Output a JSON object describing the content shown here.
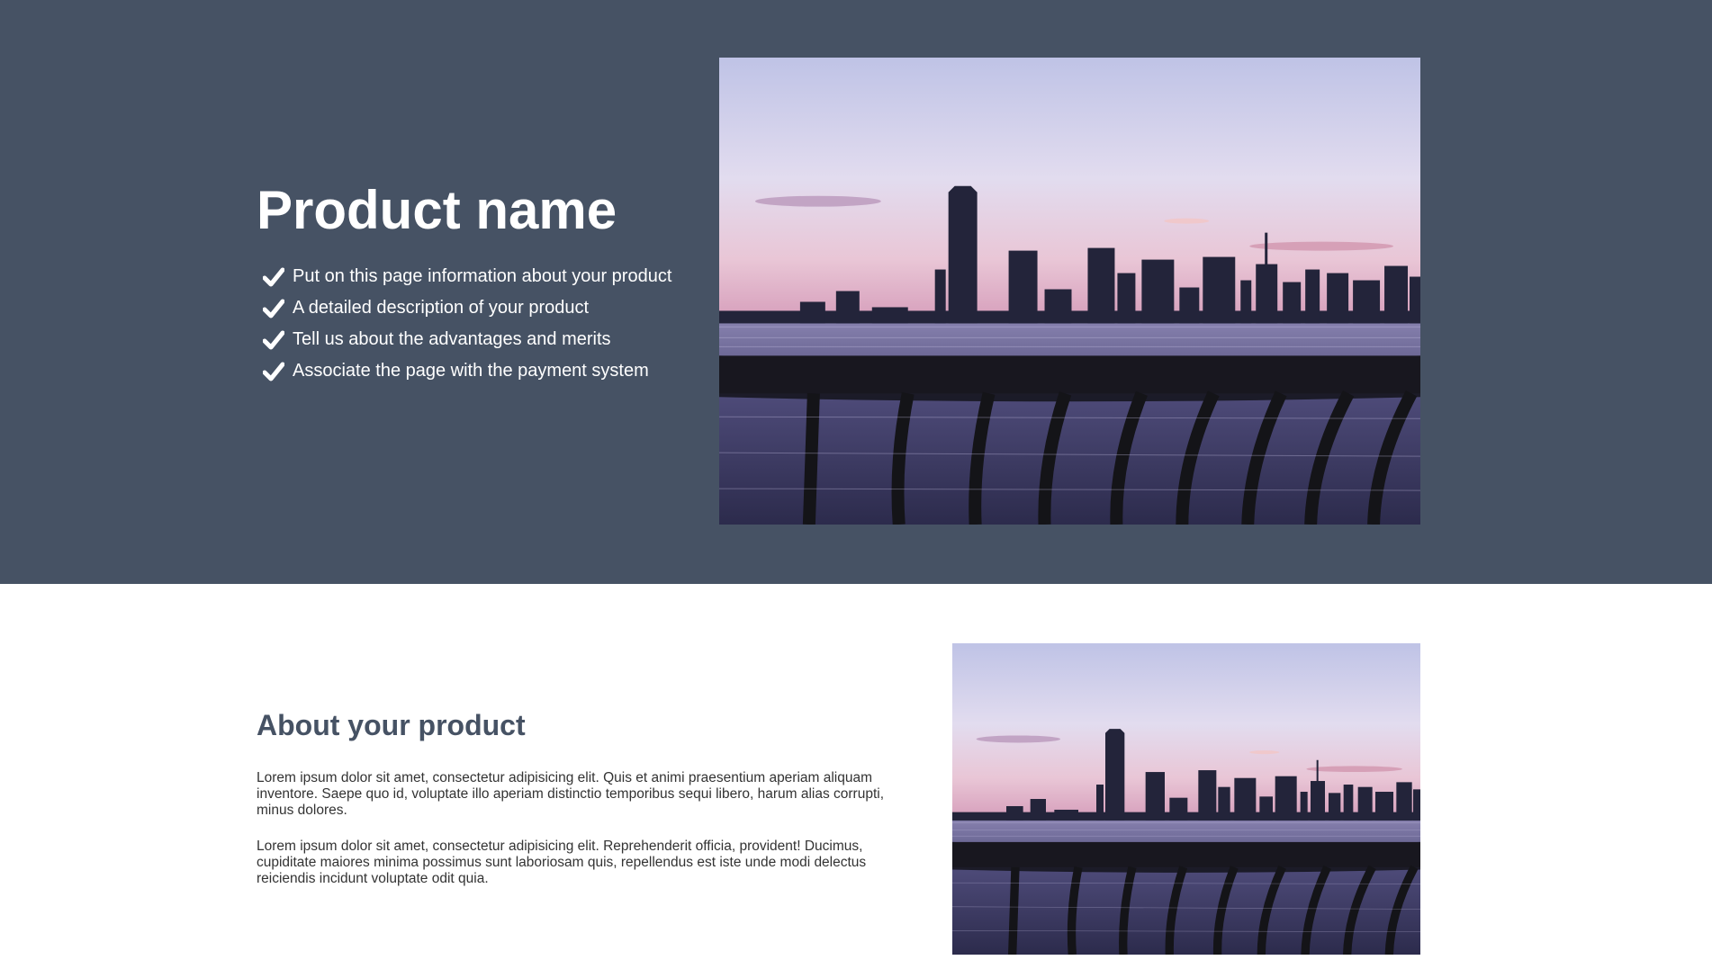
{
  "colors": {
    "hero_background": "#465264",
    "hero_text": "#ffffff",
    "about_heading": "#465264",
    "body_text": "#333333",
    "page_background": "#ffffff"
  },
  "hero": {
    "title": "Product name",
    "features": [
      {
        "icon": "checkmark-icon",
        "text": "Put on this page information about your product"
      },
      {
        "icon": "checkmark-icon",
        "text": "A detailed description of your product"
      },
      {
        "icon": "checkmark-icon",
        "text": "Tell us about the advantages and merits"
      },
      {
        "icon": "checkmark-icon",
        "text": "Associate the page with the payment system"
      }
    ],
    "image": {
      "subject": "city-skyline-at-dusk-over-river-with-railing"
    }
  },
  "about": {
    "title": "About your product",
    "paragraphs": [
      "Lorem ipsum dolor sit amet, consectetur adipisicing elit. Quis et animi praesentium aperiam aliquam inventore. Saepe quo id, voluptate illo aperiam distinctio temporibus sequi libero, harum alias corrupti, minus dolores.",
      "Lorem ipsum dolor sit amet, consectetur adipisicing elit. Reprehenderit officia, provident! Ducimus, cupiditate maiores minima possimus sunt laboriosam quis, repellendus est iste unde modi delectus reiciendis incidunt voluptate odit quia."
    ],
    "image": {
      "subject": "city-skyline-at-dusk-over-river-with-railing"
    }
  }
}
